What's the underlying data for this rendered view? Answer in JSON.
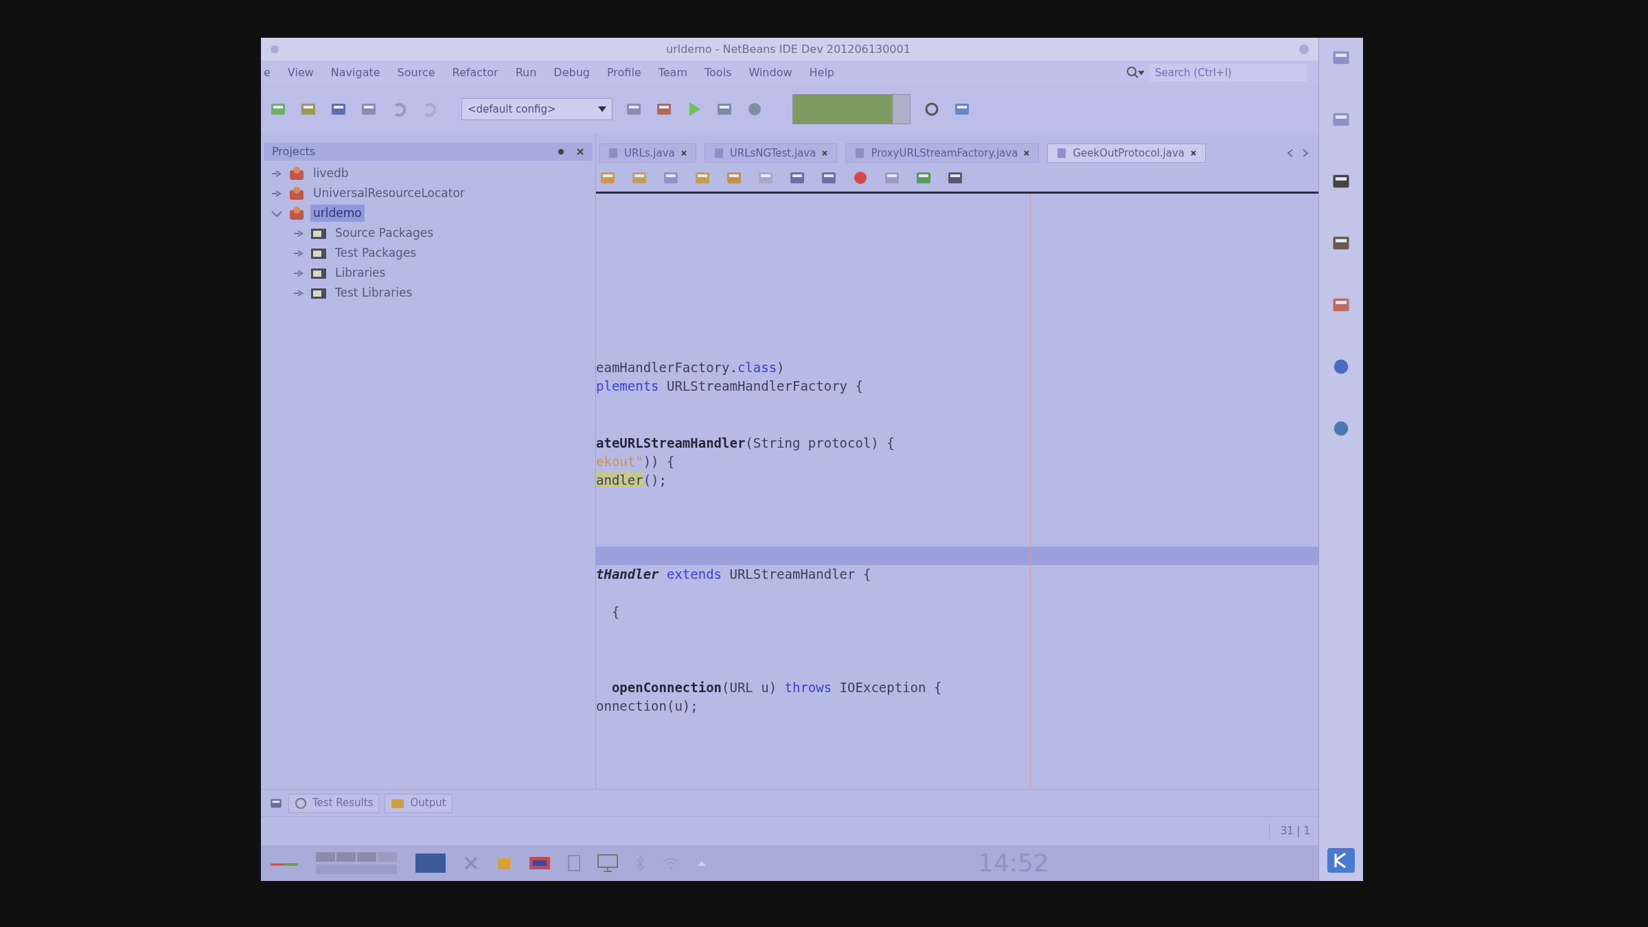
{
  "window": {
    "title": "urldemo - NetBeans IDE Dev 201206130001"
  },
  "menu": [
    "e",
    "View",
    "Navigate",
    "Source",
    "Refactor",
    "Run",
    "Debug",
    "Profile",
    "Team",
    "Tools",
    "Window",
    "Help"
  ],
  "search": {
    "placeholder": "Search (Ctrl+I)"
  },
  "toolbar": {
    "config": "<default config>",
    "memory": {
      "level": 0.85
    }
  },
  "projects": {
    "title": "Projects",
    "tree": [
      {
        "label": "livedb",
        "expanded": false,
        "selected": false
      },
      {
        "label": "UniversalResourceLocator",
        "expanded": false,
        "selected": false
      },
      {
        "label": "urldemo",
        "expanded": true,
        "selected": true,
        "children": [
          {
            "label": "Source Packages",
            "expanded": false,
            "selected": false
          },
          {
            "label": "Test Packages",
            "expanded": false,
            "selected": false
          },
          {
            "label": "Libraries",
            "expanded": false,
            "selected": false
          },
          {
            "label": "Test Libraries",
            "expanded": false,
            "selected": false
          }
        ]
      }
    ]
  },
  "editor_tabs": [
    {
      "label": "URLs.java",
      "selected": false
    },
    {
      "label": "URLsNGTest.java",
      "selected": false
    },
    {
      "label": "ProxyURLStreamFactory.java",
      "selected": false
    },
    {
      "label": "GeekOutProtocol.java",
      "selected": true
    }
  ],
  "code_lines": [
    {
      "kind": "code",
      "current": false,
      "tokens": [
        {
          "text": "eamHandlerFactory.",
          "kind": "plain"
        },
        {
          "text": "class",
          "kind": "keyword"
        },
        {
          "text": ")",
          "kind": "plain"
        }
      ]
    },
    {
      "kind": "code",
      "current": false,
      "tokens": [
        {
          "text": "plements",
          "kind": "keyword"
        },
        {
          "text": " URLStreamHandlerFactory {",
          "kind": "plain"
        }
      ]
    },
    {
      "kind": "blank",
      "current": false
    },
    {
      "kind": "blank",
      "current": false
    },
    {
      "kind": "code",
      "current": false,
      "tokens": [
        {
          "text": "ateURLStreamHandler",
          "kind": "bold"
        },
        {
          "text": "(String protocol) {",
          "kind": "plain"
        }
      ]
    },
    {
      "kind": "code",
      "current": false,
      "tokens": [
        {
          "text": "ekout\"",
          "kind": "string"
        },
        {
          "text": ")) {",
          "kind": "plain"
        }
      ]
    },
    {
      "kind": "code",
      "current": false,
      "tokens": [
        {
          "text": "andler",
          "kind": "highlight"
        },
        {
          "text": "();",
          "kind": "plain"
        }
      ]
    },
    {
      "kind": "blank",
      "current": false
    },
    {
      "kind": "blank",
      "current": false
    },
    {
      "kind": "blank",
      "current": false
    },
    {
      "kind": "blank",
      "current": true
    },
    {
      "kind": "code",
      "current": false,
      "tokens": [
        {
          "text": "tHandler",
          "kind": "bolditalic"
        },
        {
          "text": " extends",
          "kind": "keyword"
        },
        {
          "text": " URLStreamHandler {",
          "kind": "plain"
        }
      ]
    },
    {
      "kind": "blank",
      "current": false
    },
    {
      "kind": "code",
      "current": false,
      "tokens": [
        {
          "text": "  {",
          "kind": "plain"
        }
      ]
    },
    {
      "kind": "blank",
      "current": false
    },
    {
      "kind": "blank",
      "current": false
    },
    {
      "kind": "blank",
      "current": false
    },
    {
      "kind": "code",
      "current": false,
      "tokens": [
        {
          "text": "  openConnection",
          "kind": "bold"
        },
        {
          "text": "(URL u) ",
          "kind": "plain"
        },
        {
          "text": "throws",
          "kind": "keyword"
        },
        {
          "text": " IOException {",
          "kind": "plain"
        }
      ]
    },
    {
      "kind": "code",
      "current": false,
      "tokens": [
        {
          "text": "onnection(u);",
          "kind": "plain"
        }
      ]
    }
  ],
  "bottom_tabs": [
    {
      "label": "Test Results",
      "kind": "tests"
    },
    {
      "label": "Output",
      "kind": "output"
    }
  ],
  "status_bar": {
    "position": "31 | 1"
  },
  "taskbar": {
    "clock": "14:52"
  }
}
